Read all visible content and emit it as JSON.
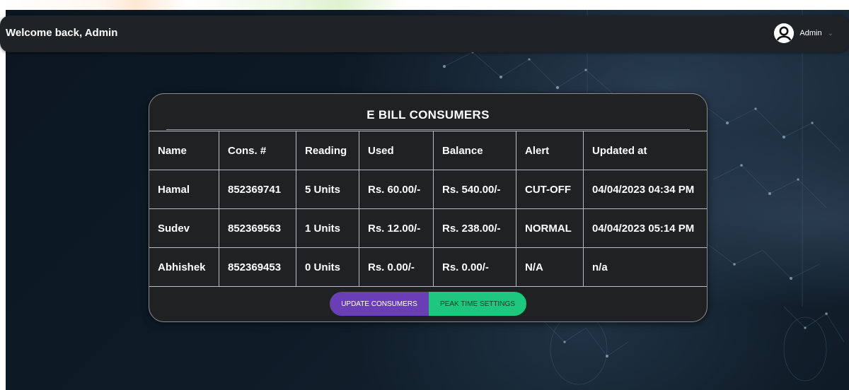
{
  "header": {
    "welcome": "Welcome back, Admin",
    "user_name": "Admin",
    "user_icon": "user-avatar-icon",
    "chevron_icon": "chevron-down-icon"
  },
  "card": {
    "title": "E BILL CONSUMERS"
  },
  "table": {
    "columns": [
      "Name",
      "Cons. #",
      "Reading",
      "Used",
      "Balance",
      "Alert",
      "Updated at"
    ],
    "rows": [
      [
        "Hamal",
        "852369741",
        "5 Units",
        "Rs. 60.00/-",
        "Rs. 540.00/-",
        "CUT-OFF",
        "04/04/2023 04:34 PM"
      ],
      [
        "Sudev",
        "852369563",
        "1 Units",
        "Rs. 12.00/-",
        "Rs. 238.00/-",
        "NORMAL",
        "04/04/2023 05:14 PM"
      ],
      [
        "Abhishek",
        "852369453",
        "0 Units",
        "Rs. 0.00/-",
        "Rs. 0.00/-",
        "N/A",
        "n/a"
      ]
    ]
  },
  "buttons": {
    "update": "UPDATE CONSUMERS",
    "peak": "PEAK TIME SETTINGS"
  },
  "colors": {
    "header_bg": "#202326",
    "card_bg": "#1f2123",
    "update_button": "#6a3fb5",
    "peak_button": "#1fc77e"
  }
}
